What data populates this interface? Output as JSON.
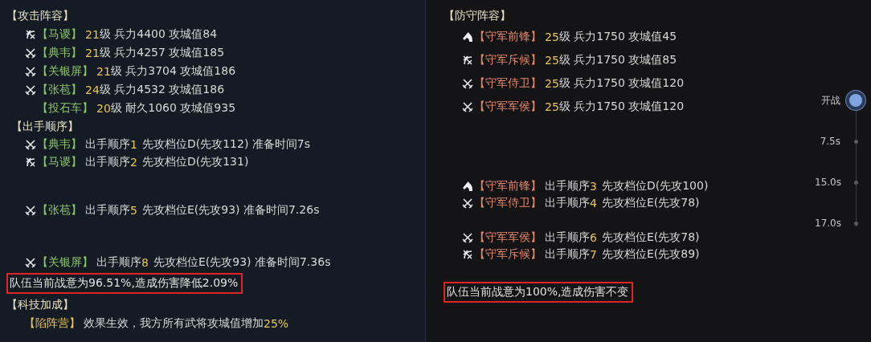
{
  "attack": {
    "title": "【攻击阵容】",
    "roster": [
      {
        "kind": "bow",
        "name": "【马谡】",
        "level": "21",
        "stats": "级 兵力4400 攻城值84"
      },
      {
        "kind": "sword",
        "name": "【典韦】",
        "level": "21",
        "stats": "级 兵力4257 攻城值185"
      },
      {
        "kind": "sword",
        "name": "【关银屏】",
        "level": "21",
        "stats": "级 兵力3704 攻城值186"
      },
      {
        "kind": "sword",
        "name": "【张苞】",
        "level": "24",
        "stats": "级 兵力4532 攻城值186"
      },
      {
        "kind": "siege",
        "name": "【投石车】",
        "level": "20",
        "stats": "级 耐久1060 攻城值935"
      }
    ],
    "order_title": "【出手顺序】",
    "orders": [
      {
        "kind": "sword",
        "name": "【典韦】",
        "label": "出手顺序",
        "order": "1",
        "detail": "先攻档位D(先攻112) 准备时间7s"
      },
      {
        "kind": "bow",
        "name": "【马谡】",
        "label": "出手顺序",
        "order": "2",
        "detail": "先攻档位D(先攻131)"
      },
      {
        "kind": "sword",
        "name": "【张苞】",
        "label": "出手顺序",
        "order": "5",
        "detail": "先攻档位E(先攻93) 准备时间7.26s"
      },
      {
        "kind": "sword",
        "name": "【关银屏】",
        "label": "出手顺序",
        "order": "8",
        "detail": "先攻档位E(先攻93) 准备时间7.36s"
      }
    ],
    "morale": "队伍当前战意为96.51%,造成伤害降低2.09%",
    "tech_title": "【科技加成】",
    "tech": {
      "name": "【陷阵营】",
      "effect": "效果生效，我方所有武将攻城值增加",
      "value": "25%"
    }
  },
  "defense": {
    "title": "【防守阵容】",
    "roster": [
      {
        "kind": "horse",
        "name": "【守军前锋】",
        "level": "25",
        "stats": "级 兵力1750 攻城值45"
      },
      {
        "kind": "bow",
        "name": "【守军斥候】",
        "level": "25",
        "stats": "级 兵力1750 攻城值85"
      },
      {
        "kind": "sword",
        "name": "【守军侍卫】",
        "level": "25",
        "stats": "级 兵力1750 攻城值120"
      },
      {
        "kind": "sword",
        "name": "【守军军侯】",
        "level": "25",
        "stats": "级 兵力1750 攻城值120"
      }
    ],
    "orders": [
      {
        "kind": "horse",
        "name": "【守军前锋】",
        "label": "出手顺序",
        "order": "3",
        "detail": "先攻档位D(先攻100)"
      },
      {
        "kind": "sword",
        "name": "【守军侍卫】",
        "label": "出手顺序",
        "order": "4",
        "detail": "先攻档位E(先攻78)"
      },
      {
        "kind": "sword",
        "name": "【守军军侯】",
        "label": "出手顺序",
        "order": "6",
        "detail": "先攻档位E(先攻78)"
      },
      {
        "kind": "bow",
        "name": "【守军斥候】",
        "label": "出手顺序",
        "order": "7",
        "detail": "先攻档位E(先攻89)"
      }
    ],
    "morale": "队伍当前战意为100%,造成伤害不变"
  },
  "timeline": [
    {
      "label": "开战",
      "selected": true
    },
    {
      "label": "7.5s",
      "selected": false
    },
    {
      "label": "15.0s",
      "selected": false
    },
    {
      "label": "17.0s",
      "selected": false
    }
  ]
}
